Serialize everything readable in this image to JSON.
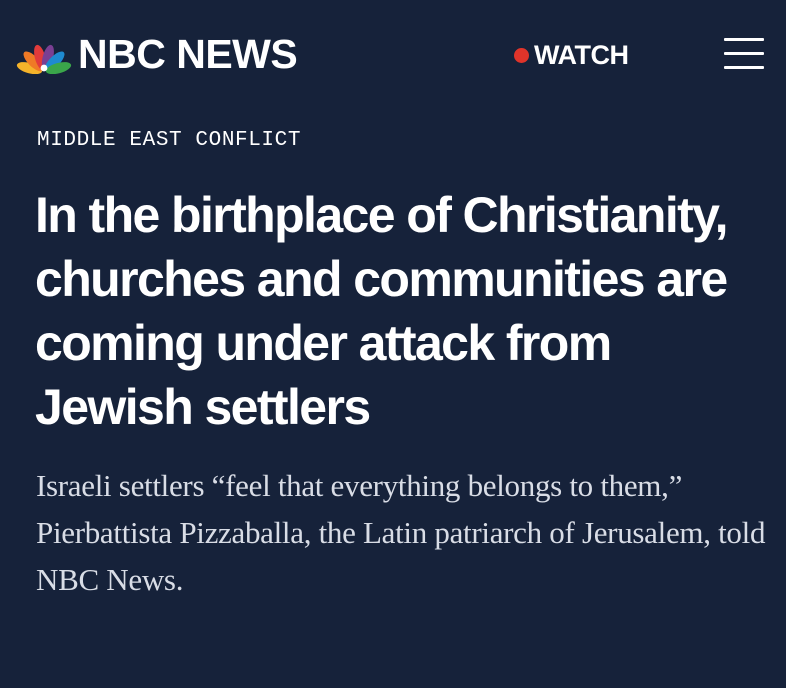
{
  "header": {
    "brand": "NBC NEWS",
    "watch_label": "WATCH",
    "colors": {
      "background": "#16223a",
      "live_dot": "#e0342a",
      "peacock": [
        "#f5b32a",
        "#ef7a26",
        "#e23b3b",
        "#7a3f93",
        "#1e8ad0",
        "#3aa64a"
      ]
    },
    "icons": [
      "nbc-peacock-logo-icon",
      "live-dot-icon",
      "hamburger-menu-icon"
    ]
  },
  "article": {
    "category": "MIDDLE EAST CONFLICT",
    "headline": "In the birthplace of Christianity, churches and communities are coming under attack from Jewish settlers",
    "dek": "Israeli settlers “feel that everything belongs to them,” Pierbattista Pizzaballa, the Latin patriarch of Jerusalem, told NBC News."
  }
}
